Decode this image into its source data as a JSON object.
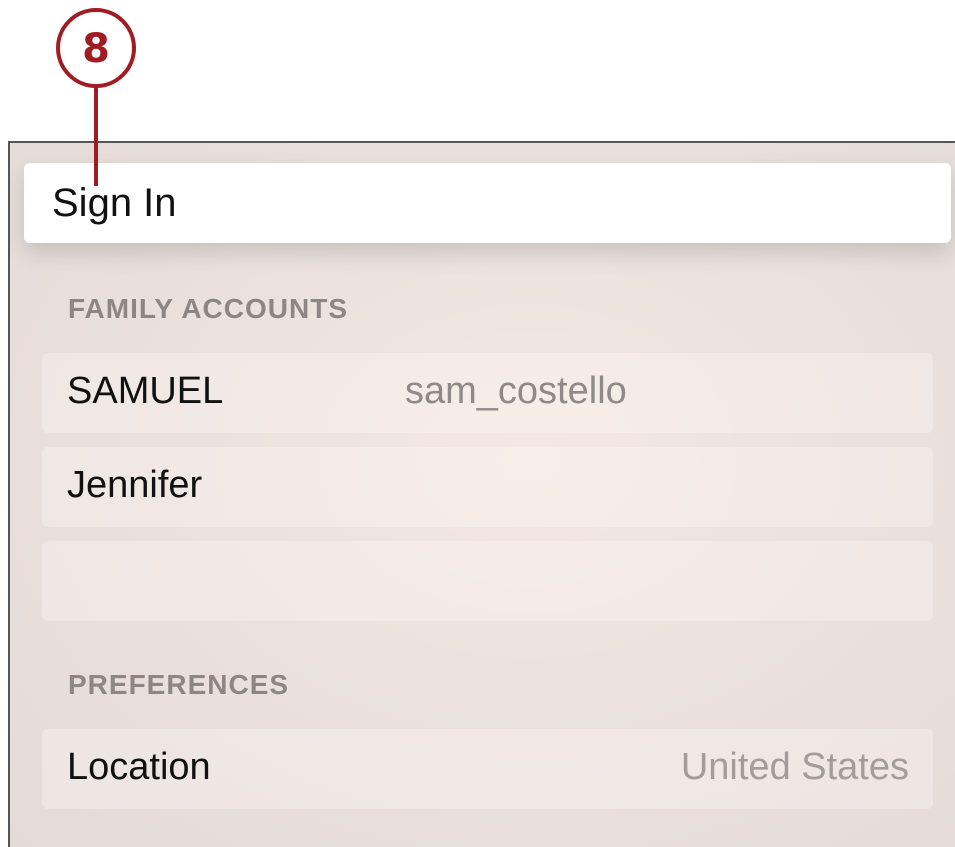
{
  "callout": {
    "number": "8",
    "color": "#a01c22"
  },
  "sign_in": {
    "label": "Sign In"
  },
  "family_accounts": {
    "header": "FAMILY ACCOUNTS",
    "accounts": [
      {
        "name": "SAMUEL",
        "username": "sam_costello"
      },
      {
        "name": "Jennifer",
        "username": ""
      },
      {
        "name": "",
        "username": ""
      }
    ]
  },
  "preferences": {
    "header": "PREFERENCES",
    "items": [
      {
        "label": "Location",
        "value": "United States"
      }
    ]
  }
}
